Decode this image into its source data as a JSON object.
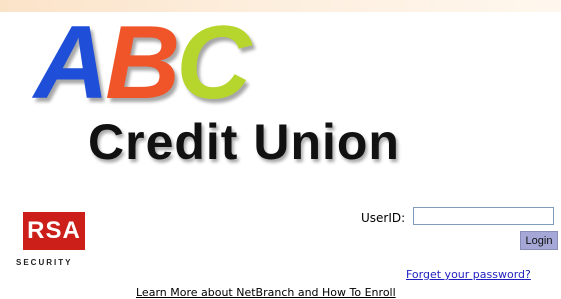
{
  "brand": {
    "abc_letters": [
      {
        "char": "A",
        "color": "#1f4fd8"
      },
      {
        "char": "B",
        "color": "#f0552a"
      },
      {
        "char": "C",
        "color": "#b6d62e"
      }
    ],
    "name": "Credit Union"
  },
  "rsa": {
    "box_text": "RSA",
    "tagline": "SECURITY",
    "color": "#cc1f1a"
  },
  "login": {
    "userid_label": "UserID:",
    "userid_value": "",
    "button_label": "Login",
    "button_color": "#a5a8d6"
  },
  "links": {
    "forgot_password": "Forget your password?",
    "learn_more": "Learn More about NetBranch and How To Enroll",
    "link_color": "#1f1fbf"
  }
}
